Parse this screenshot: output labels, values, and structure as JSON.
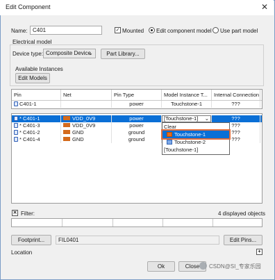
{
  "window": {
    "title": "Edit Component",
    "close_glyph": "✕"
  },
  "name": {
    "label": "Name:",
    "value": "C401"
  },
  "mounted": {
    "label": "Mounted",
    "checked": true
  },
  "mode": {
    "edit_model_label": "Edit component model",
    "use_part_label": "Use part model",
    "selected": "edit"
  },
  "electrical": {
    "group_label": "Electrical model",
    "device_type_label": "Device type:",
    "device_type_value": "Composite Device",
    "part_library_label": "Part Library...",
    "available_instances_label": "Available Instances",
    "edit_models_label": "Edit Models"
  },
  "top_table": {
    "columns": [
      "Pin",
      "Net",
      "Pin Type",
      "Model Instance T...",
      "Internal Connection"
    ],
    "rows": [
      {
        "pin": "C401-1",
        "net": "",
        "type": "power",
        "model": "Touchstone-1",
        "conn": "???"
      }
    ]
  },
  "bottom_table": {
    "rows": [
      {
        "pin": "* C401-1",
        "net": "VDD_0V9",
        "type": "power",
        "model": "[Touchstone-1]",
        "conn": "???",
        "selected": true
      },
      {
        "pin": "* C401-3",
        "net": "VDD_0V9",
        "type": "power",
        "model": "",
        "conn": "???",
        "selected": false
      },
      {
        "pin": "* C401-2",
        "net": "GND",
        "type": "ground",
        "model": "",
        "conn": "???",
        "selected": false
      },
      {
        "pin": "* C401-4",
        "net": "GND",
        "type": "ground",
        "model": "",
        "conn": "???",
        "selected": false
      }
    ],
    "dropdown": [
      "Clear",
      "Touchstone-1",
      "Touchstone-2",
      "[Touchstone-1]"
    ],
    "dropdown_highlight": 1
  },
  "filter": {
    "label": "Filter:",
    "count_text": "4 displayed objects"
  },
  "footprint": {
    "button_label": "Footprint...",
    "value": "FIL0401"
  },
  "edit_pins_label": "Edit Pins...",
  "location": {
    "label": "Location",
    "expand_glyph": "+"
  },
  "buttons": {
    "ok": "Ok",
    "close": "Close"
  },
  "watermark": "CSDN@SI_专家乐园",
  "colors": {
    "selection": "#0a6fd6",
    "highlight_outline": "#e06d3c",
    "net_icon": "#d46a1c"
  }
}
